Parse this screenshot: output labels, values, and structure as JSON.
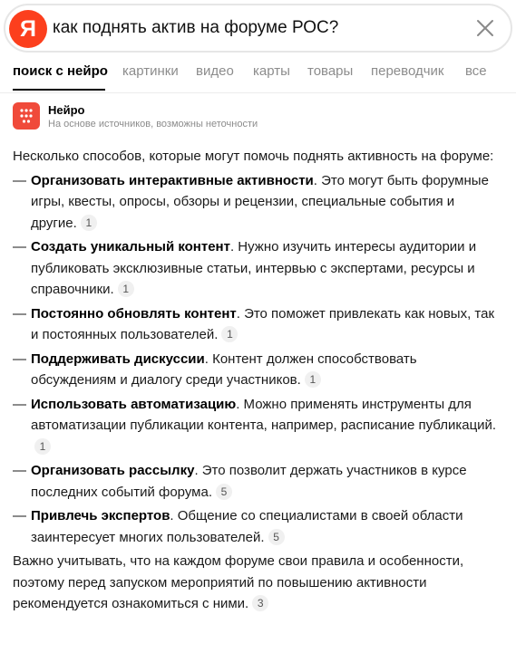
{
  "search": {
    "logo_letter": "Я",
    "query": "как поднять актив на форуме РОС?",
    "clear_icon": "close-icon"
  },
  "tabs": [
    {
      "label": "поиск с нейро",
      "active": true
    },
    {
      "label": "картинки"
    },
    {
      "label": "видео"
    },
    {
      "label": "карты"
    },
    {
      "label": "товары"
    },
    {
      "label": "переводчик"
    },
    {
      "label": "все"
    }
  ],
  "neuro": {
    "name": "Нейро",
    "subtitle": "На основе источников, возможны неточности",
    "icon": "neuro-logo-icon"
  },
  "answer": {
    "intro": "Несколько способов, которые могут помочь поднять активность на форуме:",
    "dash": "—",
    "items": [
      {
        "title": "Организовать интерактивные активности",
        "text": ". Это могут быть форумные игры, квесты, опросы, обзоры и рецензии, специальные события и другие.",
        "cite": "1"
      },
      {
        "title": "Создать уникальный контент",
        "text": ". Нужно изучить интересы аудитории и публиковать эксклюзивные статьи, интервью с экспертами, ресурсы и справочники.",
        "cite": "1"
      },
      {
        "title": "Постоянно обновлять контент",
        "text": ". Это поможет привлекать как новых, так и постоянных пользователей.",
        "cite": "1"
      },
      {
        "title": "Поддерживать дискуссии",
        "text": ". Контент должен способствовать обсуждениям и диалогу среди участников.",
        "cite": "1"
      },
      {
        "title": "Использовать автоматизацию",
        "text": ". Можно применять инструменты для автоматизации публикации контента, например, расписание публикаций.",
        "cite": "1"
      },
      {
        "title": "Организовать рассылку",
        "text": ". Это позволит держать участников в курсе последних событий форума.",
        "cite": "5"
      },
      {
        "title": "Привлечь экспертов",
        "text": ". Общение со специалистами в своей области заинтересует многих пользователей.",
        "cite": "5"
      }
    ],
    "conclusion": "Важно учитывать, что на каждом форуме свои правила и особенности, поэтому перед запуском мероприятий по повышению активности рекомендуется ознакомиться с ними.",
    "conclusion_cite": "3"
  },
  "colors": {
    "brand_red": "#fc3f1d",
    "neuro_red": "#f04a3a",
    "muted_text": "#8c8c8c"
  }
}
